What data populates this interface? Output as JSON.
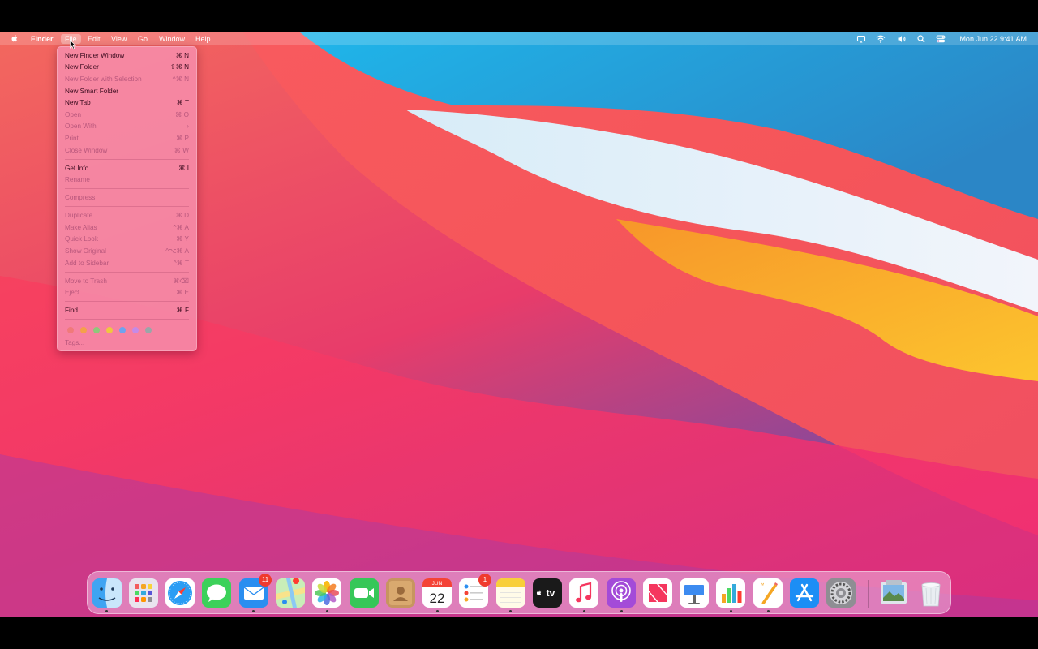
{
  "menubar": {
    "app_name": "Finder",
    "menus": [
      "File",
      "Edit",
      "View",
      "Go",
      "Window",
      "Help"
    ],
    "active_menu": "File",
    "clock": "Mon Jun 22  9:41 AM",
    "status_icons": [
      "display-mirroring-icon",
      "wifi-icon",
      "volume-icon",
      "spotlight-search-icon",
      "control-center-icon"
    ]
  },
  "file_menu": {
    "items": [
      {
        "label": "New Finder Window",
        "shortcut": "⌘ N",
        "enabled": true
      },
      {
        "label": "New Folder",
        "shortcut": "⇧⌘ N",
        "enabled": true
      },
      {
        "label": "New Folder with Selection",
        "shortcut": "^⌘ N",
        "enabled": false
      },
      {
        "label": "New Smart Folder",
        "shortcut": "",
        "enabled": true
      },
      {
        "label": "New Tab",
        "shortcut": "⌘ T",
        "enabled": true
      },
      {
        "label": "Open",
        "shortcut": "⌘ O",
        "enabled": false
      },
      {
        "label": "Open With",
        "shortcut": "›",
        "enabled": false
      },
      {
        "label": "Print",
        "shortcut": "⌘ P",
        "enabled": false
      },
      {
        "label": "Close Window",
        "shortcut": "⌘ W",
        "enabled": false
      },
      {
        "label": "Get Info",
        "shortcut": "⌘ I",
        "enabled": true
      },
      {
        "label": "Rename",
        "shortcut": "",
        "enabled": false
      },
      {
        "label": "Compress",
        "shortcut": "",
        "enabled": false
      },
      {
        "label": "Duplicate",
        "shortcut": "⌘ D",
        "enabled": false
      },
      {
        "label": "Make Alias",
        "shortcut": "^⌘ A",
        "enabled": false
      },
      {
        "label": "Quick Look",
        "shortcut": "⌘ Y",
        "enabled": false
      },
      {
        "label": "Show Original",
        "shortcut": "^⌥⌘ A",
        "enabled": false
      },
      {
        "label": "Add to Sidebar",
        "shortcut": "^⌘ T",
        "enabled": false
      },
      {
        "label": "Move to Trash",
        "shortcut": "⌘⌫",
        "enabled": false
      },
      {
        "label": "Eject",
        "shortcut": "⌘ E",
        "enabled": false
      },
      {
        "label": "Find",
        "shortcut": "⌘ F",
        "enabled": true
      }
    ],
    "tag_colors": [
      "#f07a7a",
      "#f5a04a",
      "#8fc77b",
      "#f0c640",
      "#6fa3ef",
      "#c58ae6",
      "#9aa6a8"
    ],
    "tags_label": "Tags..."
  },
  "dock": {
    "apps": [
      {
        "name": "Finder",
        "icon": "finder-icon",
        "running": true
      },
      {
        "name": "Launchpad",
        "icon": "launchpad-icon",
        "running": false
      },
      {
        "name": "Safari",
        "icon": "safari-icon",
        "running": false
      },
      {
        "name": "Messages",
        "icon": "messages-icon",
        "running": false
      },
      {
        "name": "Mail",
        "icon": "mail-icon",
        "running": true,
        "badge": "11"
      },
      {
        "name": "Maps",
        "icon": "maps-icon",
        "running": false
      },
      {
        "name": "Photos",
        "icon": "photos-icon",
        "running": true
      },
      {
        "name": "FaceTime",
        "icon": "facetime-icon",
        "running": false
      },
      {
        "name": "Contacts",
        "icon": "contacts-icon",
        "running": false
      },
      {
        "name": "Calendar",
        "icon": "calendar-icon",
        "running": true,
        "month": "JUN",
        "day": "22"
      },
      {
        "name": "Reminders",
        "icon": "reminders-icon",
        "running": false,
        "badge": "1"
      },
      {
        "name": "Notes",
        "icon": "notes-icon",
        "running": true
      },
      {
        "name": "TV",
        "icon": "tv-icon",
        "running": false,
        "label": "tv"
      },
      {
        "name": "Music",
        "icon": "music-icon",
        "running": true
      },
      {
        "name": "Podcasts",
        "icon": "podcasts-icon",
        "running": true
      },
      {
        "name": "News",
        "icon": "news-icon",
        "running": false
      },
      {
        "name": "Keynote",
        "icon": "keynote-icon",
        "running": false
      },
      {
        "name": "Numbers",
        "icon": "numbers-icon",
        "running": true
      },
      {
        "name": "Pages",
        "icon": "pages-icon",
        "running": true
      },
      {
        "name": "App Store",
        "icon": "app-store-icon",
        "running": false
      },
      {
        "name": "System Preferences",
        "icon": "system-preferences-icon",
        "running": false
      },
      {
        "name": "Preview",
        "icon": "preview-icon",
        "running": false
      },
      {
        "name": "Trash",
        "icon": "trash-icon",
        "running": false
      }
    ]
  }
}
